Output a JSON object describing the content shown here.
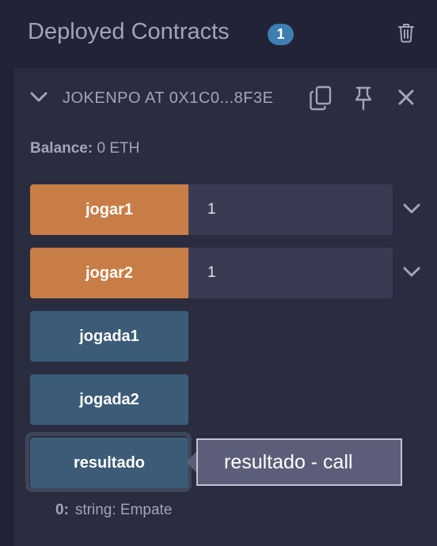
{
  "header": {
    "title": "Deployed Contracts",
    "count": "1"
  },
  "contract": {
    "name": "JOKENPO AT 0X1C0...8F3E",
    "balance_label": "Balance:",
    "balance_value": "0 ETH"
  },
  "functions": [
    {
      "label": "jogar1",
      "kind": "payable",
      "input_value": "1"
    },
    {
      "label": "jogar2",
      "kind": "payable",
      "input_value": "1"
    },
    {
      "label": "jogada1",
      "kind": "view"
    },
    {
      "label": "jogada2",
      "kind": "view"
    },
    {
      "label": "resultado",
      "kind": "view"
    }
  ],
  "tooltip": {
    "text": "resultado - call"
  },
  "output": {
    "index": "0:",
    "value": "string: Empate"
  },
  "colors": {
    "background": "#222336",
    "panel": "#2a2c3f",
    "payable_button": "#c97d46",
    "view_button": "#3b5b77",
    "badge": "#3d7fb0",
    "muted_text": "#a2a3bd"
  }
}
